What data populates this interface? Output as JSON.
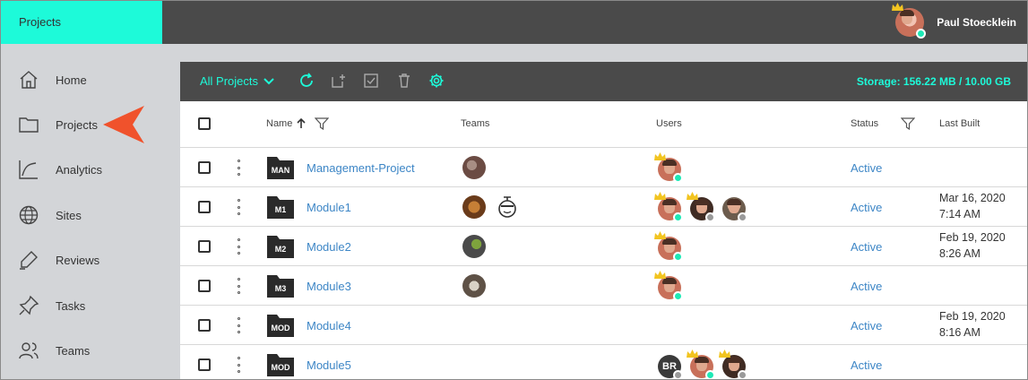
{
  "topbar": {
    "brand_tab": "Projects",
    "user_name": "Paul Stoecklein"
  },
  "sidebar": {
    "items": [
      {
        "label": "Home",
        "icon": "home-icon"
      },
      {
        "label": "Projects",
        "icon": "folder-icon"
      },
      {
        "label": "Analytics",
        "icon": "analytics-icon"
      },
      {
        "label": "Sites",
        "icon": "globe-icon"
      },
      {
        "label": "Reviews",
        "icon": "pen-icon"
      },
      {
        "label": "Tasks",
        "icon": "pin-icon"
      },
      {
        "label": "Teams",
        "icon": "people-icon"
      }
    ],
    "pointer_color": "#f0522c"
  },
  "toolbar": {
    "filter_label": "All Projects",
    "storage_label": "Storage: 156.22 MB / 10.00 GB",
    "icons": [
      "refresh-icon",
      "new-project-icon",
      "select-all-icon",
      "delete-icon",
      "settings-icon"
    ]
  },
  "table": {
    "headers": {
      "name": "Name",
      "teams": "Teams",
      "users": "Users",
      "status": "Status",
      "last_built": "Last Built"
    },
    "rows": [
      {
        "abbr": "MAN",
        "name": "Management-Project",
        "status": "Active",
        "built_date": "",
        "built_time": ""
      },
      {
        "abbr": "M1",
        "name": "Module1",
        "status": "Active",
        "built_date": "Mar 16, 2020",
        "built_time": "7:14 AM"
      },
      {
        "abbr": "M2",
        "name": "Module2",
        "status": "Active",
        "built_date": "Feb 19, 2020",
        "built_time": "8:26 AM"
      },
      {
        "abbr": "M3",
        "name": "Module3",
        "status": "Active",
        "built_date": "",
        "built_time": ""
      },
      {
        "abbr": "MOD",
        "name": "Module4",
        "status": "Active",
        "built_date": "Feb 19, 2020",
        "built_time": "8:16 AM"
      },
      {
        "abbr": "MOD",
        "name": "Module5",
        "status": "Active",
        "built_date": "",
        "built_time": ""
      }
    ],
    "user_initials": "BR"
  },
  "colors": {
    "accent": "#1dfad9",
    "link": "#3d86c6",
    "topbar": "#4a4a4a",
    "sidebar": "#d3d5d8",
    "online": "#1de9b6"
  }
}
